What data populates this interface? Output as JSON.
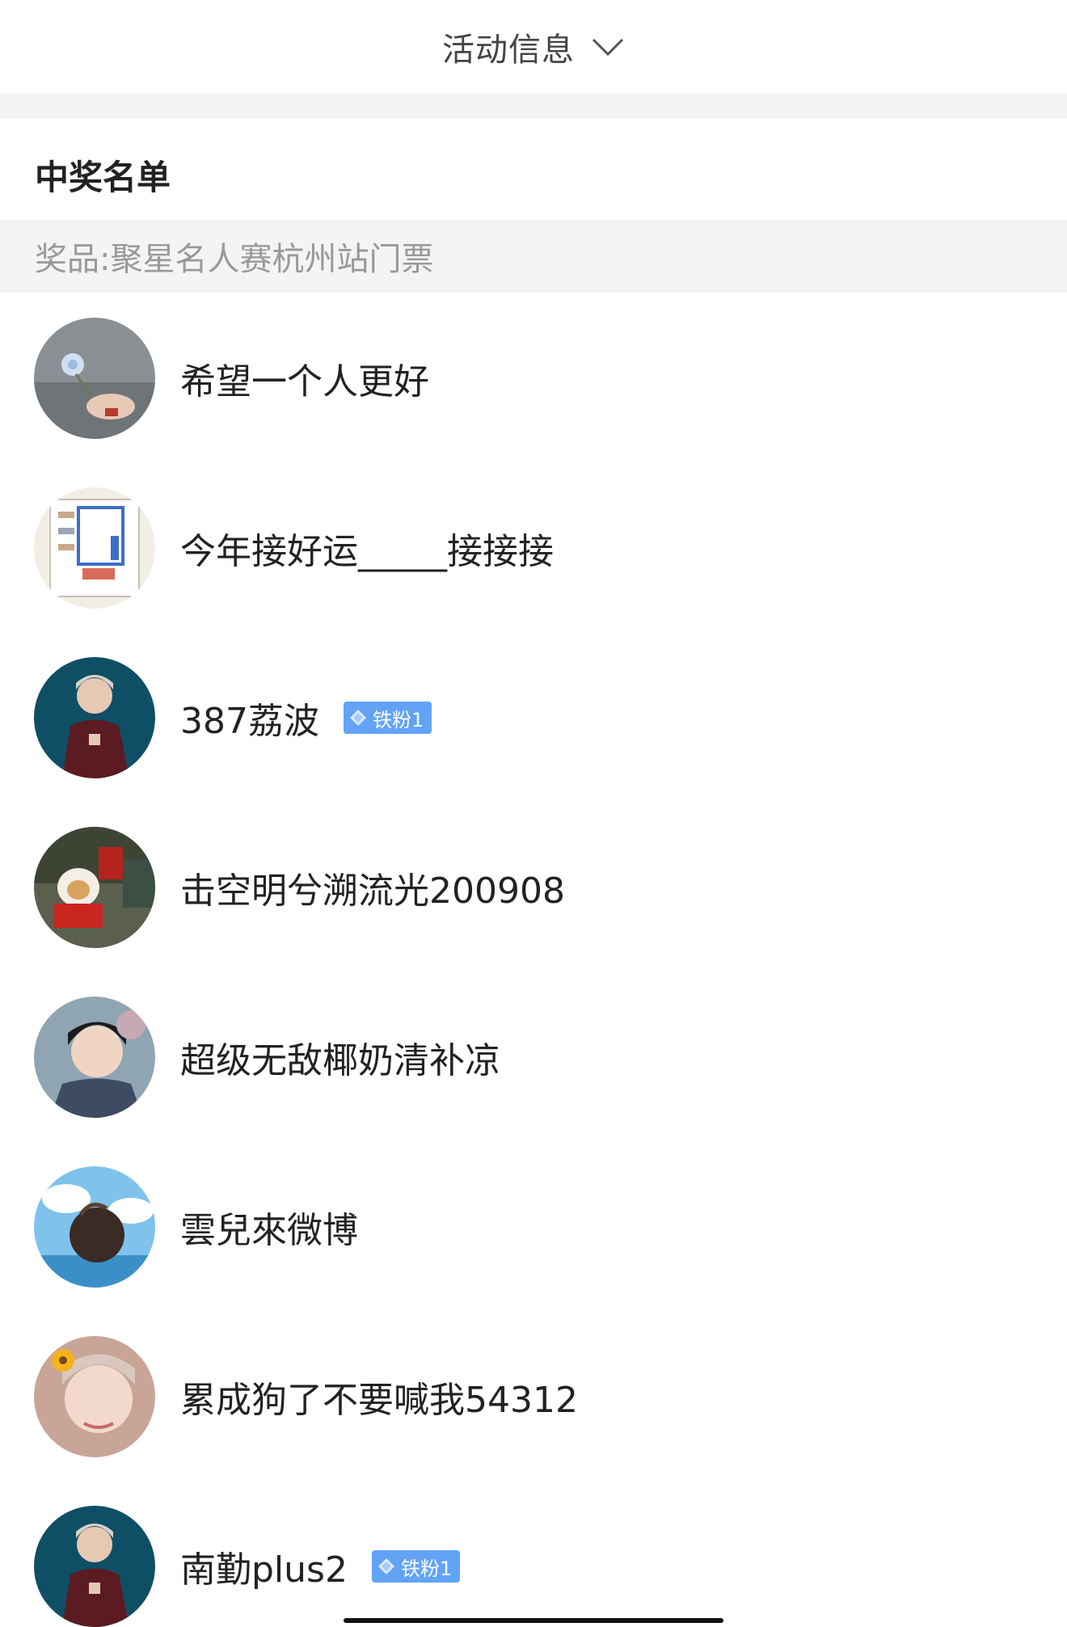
{
  "header": {
    "title": "活动信息"
  },
  "section": {
    "title": "中奖名单"
  },
  "prize": {
    "text": "奖品:聚星名人赛杭州站门票"
  },
  "winners": [
    {
      "name": "希望一个人更好",
      "badge": ""
    },
    {
      "name": "今年接好运_____接接接",
      "badge": ""
    },
    {
      "name": "387荔波",
      "badge": "铁粉1"
    },
    {
      "name": "击空明兮溯流光200908",
      "badge": ""
    },
    {
      "name": "超级无敌椰奶清补凉",
      "badge": ""
    },
    {
      "name": "雲兒來微博",
      "badge": ""
    },
    {
      "name": "累成狗了不要喊我54312",
      "badge": ""
    },
    {
      "name": "南勤plus2",
      "badge": "铁粉1"
    }
  ],
  "colors": {
    "badge": "#62a3f6",
    "band": "#f4f4f4",
    "muted_text": "#999999"
  }
}
